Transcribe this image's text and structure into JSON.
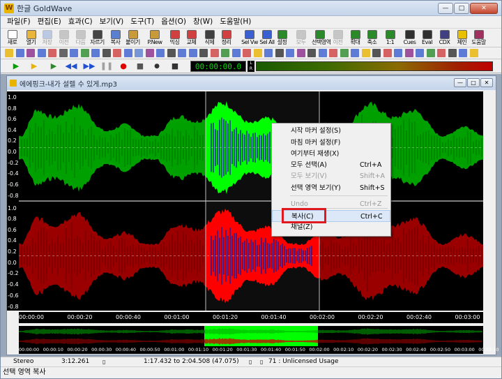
{
  "app": {
    "title": "한글 GoldWave",
    "logo": "W"
  },
  "window_controls": {
    "minimize": "—",
    "maximize": "□",
    "close": "✕"
  },
  "menu": [
    "파일(F)",
    "편집(E)",
    "효과(C)",
    "보기(V)",
    "도구(T)",
    "옵션(O)",
    "창(W)",
    "도움말(H)"
  ],
  "toolbar": [
    {
      "label": "새로",
      "icon": "new-file-icon",
      "color": "#ffffff",
      "enabled": true
    },
    {
      "label": "열기",
      "icon": "open-folder-icon",
      "color": "#e8b43a",
      "enabled": true
    },
    {
      "label": "저장",
      "icon": "save-icon",
      "color": "#5a7fd0",
      "enabled": false
    },
    {
      "label": "이전",
      "icon": "undo-icon",
      "color": "#7a7a7a",
      "enabled": false
    },
    {
      "label": "다음",
      "icon": "redo-icon",
      "color": "#7a7a7a",
      "enabled": false
    },
    {
      "label": "자르기",
      "icon": "scissors-icon",
      "color": "#444444",
      "enabled": true
    },
    {
      "label": "복사",
      "icon": "copy-icon",
      "color": "#5a7fd0",
      "enabled": true
    },
    {
      "label": "붙이기",
      "icon": "paste-icon",
      "color": "#c89a3a",
      "enabled": true
    },
    {
      "label": "P.New",
      "icon": "paste-new-icon",
      "color": "#c89a3a",
      "enabled": true
    },
    {
      "label": "믹싱",
      "icon": "mix-icon",
      "color": "#d04040",
      "enabled": true
    },
    {
      "label": "교체",
      "icon": "replace-icon",
      "color": "#d04040",
      "enabled": true
    },
    {
      "label": "삭제",
      "icon": "delete-icon",
      "color": "#404040",
      "enabled": true
    },
    {
      "label": "정리",
      "icon": "trim-icon",
      "color": "#d04040",
      "enabled": true
    },
    {
      "label": "Sel Vw",
      "icon": "select-view-icon",
      "color": "#3a5fd0",
      "enabled": true
    },
    {
      "label": "Sel All",
      "icon": "select-all-icon",
      "color": "#3a5fd0",
      "enabled": true
    },
    {
      "label": "설정",
      "icon": "settings-icon",
      "color": "#2a8a2a",
      "enabled": true
    },
    {
      "label": "모두",
      "icon": "zoom-all-icon",
      "color": "#7a7a7a",
      "enabled": false
    },
    {
      "label": "선택영역",
      "icon": "zoom-selection-icon",
      "color": "#2a8a2a",
      "enabled": true
    },
    {
      "label": "이전",
      "icon": "zoom-previous-icon",
      "color": "#7a7a7a",
      "enabled": false
    },
    {
      "label": "확대",
      "icon": "zoom-in-icon",
      "color": "#2a8a2a",
      "enabled": true
    },
    {
      "label": "축소",
      "icon": "zoom-out-icon",
      "color": "#2a8a2a",
      "enabled": true
    },
    {
      "label": "1:1",
      "icon": "zoom-1-1-icon",
      "color": "#2a8a2a",
      "enabled": true
    },
    {
      "label": "Cues",
      "icon": "cues-icon",
      "color": "#303030",
      "enabled": true
    },
    {
      "label": "Eval",
      "icon": "eval-icon",
      "color": "#303030",
      "enabled": true
    },
    {
      "label": "CDX",
      "icon": "cdx-icon",
      "color": "#404080",
      "enabled": true
    },
    {
      "label": "제인",
      "icon": "help-book-icon",
      "color": "#e8c000",
      "enabled": true
    },
    {
      "label": "도움말",
      "icon": "help-icon",
      "color": "#a03060",
      "enabled": true
    }
  ],
  "effects_toolbar_colors": [
    "#e8b400",
    "#3a5fd0",
    "#8a2a8a",
    "#3a5fd0",
    "#d04040",
    "#444444",
    "#3a5fd0",
    "#2a8a2a",
    "#3a5fd0",
    "#303030",
    "#d04040",
    "#3a5fd0",
    "#5a7fd0",
    "#8a2a8a",
    "#3a5fd0",
    "#303030",
    "#3a5fd0",
    "#3a5fd0",
    "#303030",
    "#d04040",
    "#2a8a2a",
    "#3a5fd0",
    "#d04040",
    "#e8b400",
    "#3a5fd0",
    "#303030",
    "#3a5fd0",
    "#8a2a8a",
    "#303030",
    "#3a5fd0",
    "#d04040",
    "#2a8a2a",
    "#3a5fd0",
    "#e8b400",
    "#303030",
    "#d04040",
    "#3a5fd0",
    "#8a2a8a",
    "#3a5fd0",
    "#2a8a2a",
    "#d04040",
    "#303030",
    "#3a5fd0",
    "#e8b400"
  ],
  "transport": {
    "play": "▶",
    "play_selection": "▶",
    "rewind": "◀◀",
    "fast_forward": "▶▶",
    "pause": "❚❚",
    "record": "●",
    "stop": "■",
    "time": "00:00:00.0",
    "meter_left": "L",
    "meter_right": "R"
  },
  "document": {
    "title": "에에핑크-내가 설렐 수 있게.mp3"
  },
  "waveform": {
    "channels": [
      "left",
      "right"
    ],
    "colors": {
      "left": "#00a000",
      "right": "#9a0000",
      "left_selected": "#00ff00",
      "right_selected": "#ff0000",
      "peak": "#1a1aa0"
    },
    "y_labels": [
      "1.0",
      "0.8",
      "0.6",
      "0.4",
      "0.2",
      "0.0",
      "-0.2",
      "-0.4",
      "-0.6",
      "-0.8",
      "1.0",
      "0.8",
      "0.6",
      "0.4",
      "0.2",
      "0.0",
      "-0.2",
      "-0.4",
      "-0.6",
      "-0.8"
    ],
    "time_labels": [
      "00:00:00",
      "00:00:20",
      "00:00:40",
      "00:01:00",
      "00:01:20",
      "00:01:40",
      "00:02:00",
      "00:02:20",
      "00:02:40",
      "00:03:00"
    ],
    "overview_labels": [
      "00:00:00",
      "00:00:10",
      "00:00:20",
      "00:00:30",
      "00:00:40",
      "00:00:50",
      "00:01:00",
      "00:01:10",
      "00:01:20",
      "00:01:30",
      "00:01:40",
      "00:01:50",
      "00:02:00",
      "00:02:10",
      "00:02:20",
      "00:02:30",
      "00:02:40",
      "00:02:50",
      "00:03:00",
      "00:03:10"
    ]
  },
  "context_menu": [
    {
      "label": "시작 마커 설정(S)",
      "shortcut": "",
      "enabled": true
    },
    {
      "label": "마침 마커 설정(F)",
      "shortcut": "",
      "enabled": true
    },
    {
      "label": "여기부터 재생(X)",
      "shortcut": "",
      "enabled": true
    },
    {
      "label": "모두 선택(A)",
      "shortcut": "Ctrl+A",
      "enabled": true
    },
    {
      "label": "모두 보기(V)",
      "shortcut": "Shift+A",
      "enabled": false
    },
    {
      "label": "선택 영역 보기(Y)",
      "shortcut": "Shift+S",
      "enabled": true
    },
    {
      "label": "Undo",
      "shortcut": "Ctrl+Z",
      "enabled": false
    },
    {
      "label": "복사(C)",
      "shortcut": "Ctrl+C",
      "enabled": true,
      "highlighted": true
    },
    {
      "label": "채널(Z)",
      "shortcut": "",
      "enabled": true
    }
  ],
  "status": {
    "mode": "Stereo",
    "length": "3:12.261",
    "selection": "1:17.432 to 2:04.508 (47.075)",
    "info": "71 : Unlicensed Usage",
    "hint": "선택 영역 복사"
  }
}
